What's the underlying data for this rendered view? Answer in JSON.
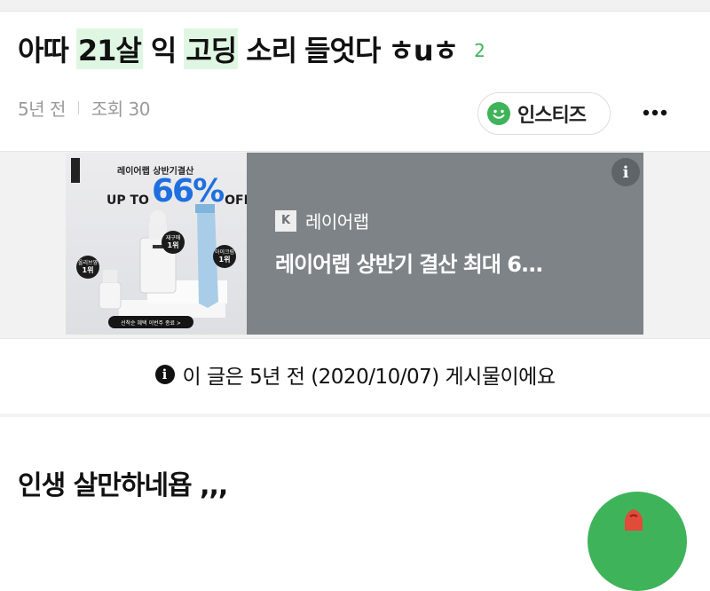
{
  "post": {
    "title_parts": [
      "아따",
      "21살",
      "익",
      "고딩",
      "소리",
      "들엇다",
      "ㅎuㅎ"
    ],
    "comment_count": "2",
    "age": "5년 전",
    "views": "조회 30",
    "board": "인스티즈",
    "body_text": "인생 살만하네욥 ,,,"
  },
  "ad": {
    "image_title": "레이어랩 상반기결산",
    "promo_upto": "UP TO",
    "promo_percent": "66%",
    "promo_off": "OFF",
    "badge1": {
      "line1": "올리브영",
      "line2": "1위"
    },
    "badge2": {
      "line1": "재구매",
      "line2": "1위"
    },
    "badge3": {
      "line1": "아이크림",
      "line2": "1위"
    },
    "cta": "선착순 혜택 이번주 종료 >",
    "brand_initial": "K",
    "brand_name": "레이어랩",
    "headline": "레이어랩 상반기 결산 최대 6...",
    "info_icon": "i"
  },
  "notice": {
    "icon": "i",
    "text": "이 글은 5년 전 (2020/10/07) 게시물이에요"
  },
  "colors": {
    "highlight": "#dff7e2",
    "accent": "#3fb35a",
    "ad_panel": "#7d8387"
  }
}
